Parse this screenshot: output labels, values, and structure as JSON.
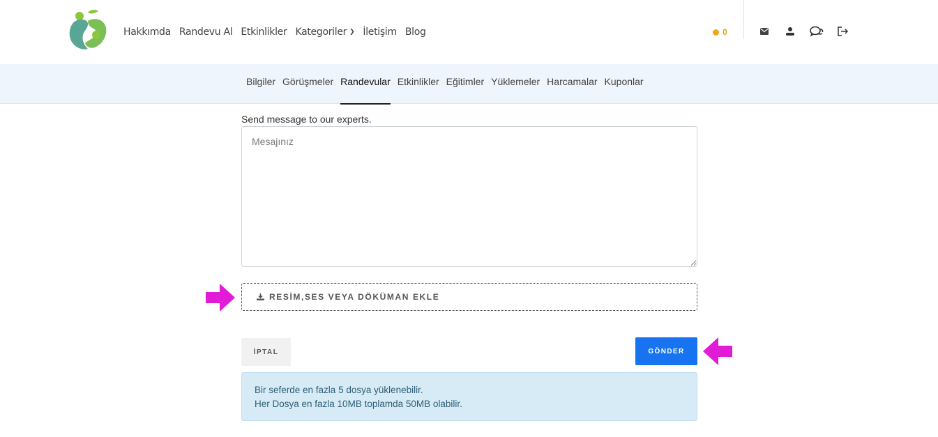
{
  "header": {
    "nav": [
      {
        "label": "Hakkımda"
      },
      {
        "label": "Randevu Al"
      },
      {
        "label": "Etkinlikler"
      },
      {
        "label": "Kategoriler"
      },
      {
        "label": "İletişim"
      },
      {
        "label": "Blog"
      }
    ],
    "coin_count": "0",
    "icons": [
      "mail-icon",
      "user-icon",
      "chat-icon",
      "logout-icon"
    ]
  },
  "subnav": {
    "tabs": [
      {
        "label": "Bilgiler"
      },
      {
        "label": "Görüşmeler"
      },
      {
        "label": "Randevular"
      },
      {
        "label": "Etkinlikler"
      },
      {
        "label": "Eğitimler"
      },
      {
        "label": "Yüklemeler"
      },
      {
        "label": "Harcamalar"
      },
      {
        "label": "Kuponlar"
      }
    ],
    "active_tab": "Randevular"
  },
  "form": {
    "label": "Send message to our experts.",
    "message_placeholder": "Mesajınız",
    "message_value": "",
    "upload_label": "RESİM,SES VEYA DÖKÜMAN EKLE",
    "cancel_label": "İPTAL",
    "send_label": "GÖNDER"
  },
  "info": {
    "line1": "Bir seferde en fazla 5 dosya yüklenebilir.",
    "line2": "Her Dosya en fazla 10MB toplamda 50MB olabilir."
  },
  "colors": {
    "accent": "#1773f0",
    "annotation_arrow": "#e21bd6",
    "info_bg": "#d7ebf6",
    "coin": "#f0a818",
    "logo_green": "#6ab04c",
    "logo_teal": "#5aa694"
  }
}
